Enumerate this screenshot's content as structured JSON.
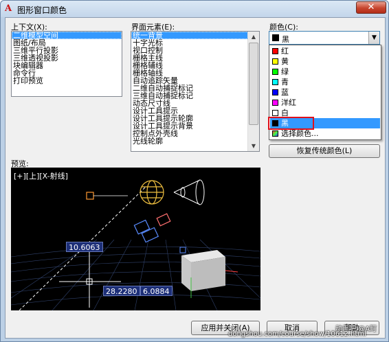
{
  "window": {
    "title": "图形窗口颜色",
    "close_glyph": "✕"
  },
  "context": {
    "label": "上下文(X):",
    "items": [
      "二维模型空间",
      "图纸/布局",
      "三维平行投影",
      "三维透视投影",
      "块编辑器",
      "命令行",
      "打印预览"
    ],
    "selected_index": 0
  },
  "interface": {
    "label": "界面元素(E):",
    "items": [
      "统一背景",
      "十字光标",
      "视口控制",
      "栅格主线",
      "栅格辅线",
      "栅格轴线",
      "自动追踪矢量",
      "二维自动捕捉标记",
      "三维自动捕捉标记",
      "动态尺寸线",
      "设计工具提示",
      "设计工具提示轮廓",
      "设计工具提示背景",
      "控制点外壳线",
      "光线轮廓"
    ],
    "selected_index": 0
  },
  "color": {
    "label": "颜色(C):",
    "selected_name": "黑",
    "selected_hex": "#000000",
    "options": [
      {
        "name": "红",
        "hex": "#ff0000"
      },
      {
        "name": "黄",
        "hex": "#ffff00"
      },
      {
        "name": "绿",
        "hex": "#00ff00"
      },
      {
        "name": "青",
        "hex": "#00ffff"
      },
      {
        "name": "蓝",
        "hex": "#0000ff"
      },
      {
        "name": "洋红",
        "hex": "#ff00ff"
      },
      {
        "name": "白",
        "hex": "#ffffff"
      },
      {
        "name": "黑",
        "hex": "#000000"
      },
      {
        "name": "选择颜色...",
        "hex": ""
      }
    ],
    "highlighted_index": 7,
    "restore_button": "恢复传统颜色(L)"
  },
  "preview": {
    "label": "预览:",
    "viewport_label": "[+][上][X-射线]",
    "dim_vertical": "10.6063",
    "dim_x": "28.2280",
    "dim_y": "6.0884"
  },
  "buttons": {
    "apply_close": "应用并关闭(A)",
    "cancel": "取消",
    "help": "帮助"
  },
  "watermark": {
    "line1": "动手吧 @A町",
    "line2": "dongshou.com/course/show/10612.html"
  },
  "colors": {
    "selection": "#3399ff",
    "highlight_outline": "#e0101a"
  }
}
